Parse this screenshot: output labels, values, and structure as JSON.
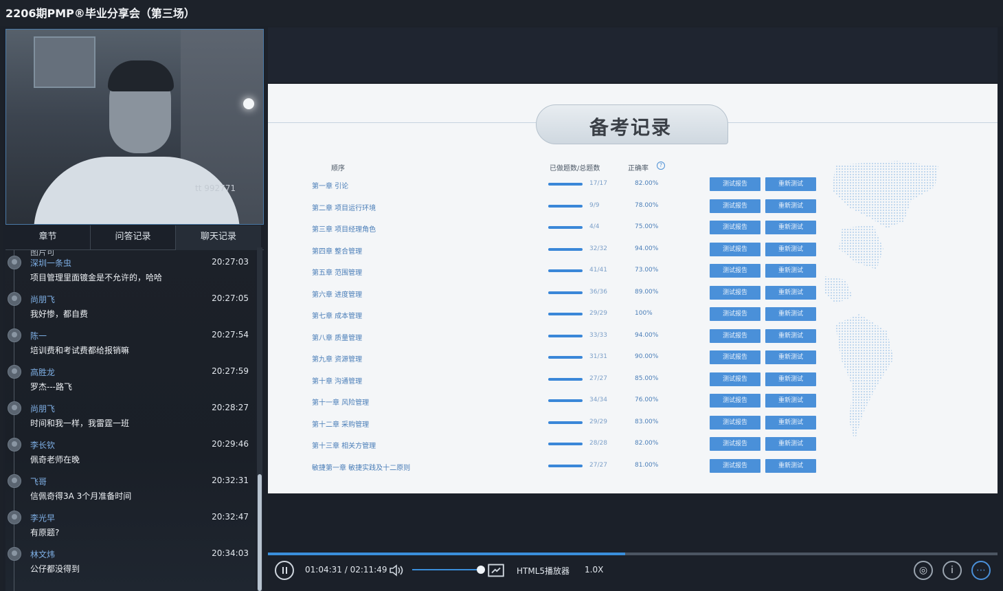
{
  "window": {
    "title": "2206期PMP®毕业分享会（第三场）"
  },
  "video": {
    "watermark": "tt 992771"
  },
  "tabs": [
    {
      "label": "章节"
    },
    {
      "label": "问答记录"
    },
    {
      "label": "聊天记录"
    }
  ],
  "chat": {
    "partial_text": "图片可",
    "messages": [
      {
        "name": "深圳一条虫",
        "time": "20:27:03",
        "text": "项目管理里面镀金是不允许的，哈哈"
      },
      {
        "name": "尚朋飞",
        "time": "20:27:05",
        "text": "我好惨，都自费"
      },
      {
        "name": "陈一",
        "time": "20:27:54",
        "text": "培训费和考试费都给报销嘛"
      },
      {
        "name": "高胜龙",
        "time": "20:27:59",
        "text": "罗杰---路飞"
      },
      {
        "name": "尚朋飞",
        "time": "20:28:27",
        "text": "时间和我一样，我雷霆一班"
      },
      {
        "name": "李长钦",
        "time": "20:29:46",
        "text": "佩奇老师在晚"
      },
      {
        "name": "飞哥",
        "time": "20:32:31",
        "text": "信佩奇得3A 3个月准备时间"
      },
      {
        "name": "李光早",
        "time": "20:32:47",
        "text": "有原题?"
      },
      {
        "name": "林文炜",
        "time": "20:34:03",
        "text": "公仔都没得到"
      }
    ]
  },
  "slide": {
    "title": "备考记录",
    "headers": {
      "order": "顺序",
      "questions": "已做题数/总题数",
      "accuracy": "正确率",
      "help": "?"
    },
    "button_report": "测试报告",
    "button_retest": "重新测试",
    "rows": [
      {
        "chapter": "第一章 引论",
        "questions": "17/17",
        "accuracy": "82.00%",
        "completion": 1.0
      },
      {
        "chapter": "第二章 项目运行环境",
        "questions": "9/9",
        "accuracy": "78.00%",
        "completion": 1.0
      },
      {
        "chapter": "第三章 项目经理角色",
        "questions": "4/4",
        "accuracy": "75.00%",
        "completion": 1.0
      },
      {
        "chapter": "第四章 整合管理",
        "questions": "32/32",
        "accuracy": "94.00%",
        "completion": 1.0
      },
      {
        "chapter": "第五章 范围管理",
        "questions": "41/41",
        "accuracy": "73.00%",
        "completion": 1.0
      },
      {
        "chapter": "第六章 进度管理",
        "questions": "36/36",
        "accuracy": "89.00%",
        "completion": 1.0
      },
      {
        "chapter": "第七章 成本管理",
        "questions": "29/29",
        "accuracy": "100%",
        "completion": 1.0
      },
      {
        "chapter": "第八章 质量管理",
        "questions": "33/33",
        "accuracy": "94.00%",
        "completion": 1.0
      },
      {
        "chapter": "第九章 资源管理",
        "questions": "31/31",
        "accuracy": "90.00%",
        "completion": 1.0
      },
      {
        "chapter": "第十章 沟通管理",
        "questions": "27/27",
        "accuracy": "85.00%",
        "completion": 1.0
      },
      {
        "chapter": "第十一章 风险管理",
        "questions": "34/34",
        "accuracy": "76.00%",
        "completion": 1.0
      },
      {
        "chapter": "第十二章 采购管理",
        "questions": "29/29",
        "accuracy": "83.00%",
        "completion": 1.0
      },
      {
        "chapter": "第十三章 相关方管理",
        "questions": "28/28",
        "accuracy": "82.00%",
        "completion": 1.0
      },
      {
        "chapter": "敏捷第一章 敏捷实践及十二原则",
        "questions": "27/27",
        "accuracy": "81.00%",
        "completion": 1.0
      }
    ]
  },
  "player": {
    "time": "01:04:31 / 02:11:49",
    "progress": 0.49,
    "volume": 1.0,
    "player_name": "HTML5播放器",
    "speed": "1.0X"
  },
  "colors": {
    "accent": "#3a8edb",
    "button": "#4a90d9",
    "chat_name": "#7fb0e6"
  }
}
